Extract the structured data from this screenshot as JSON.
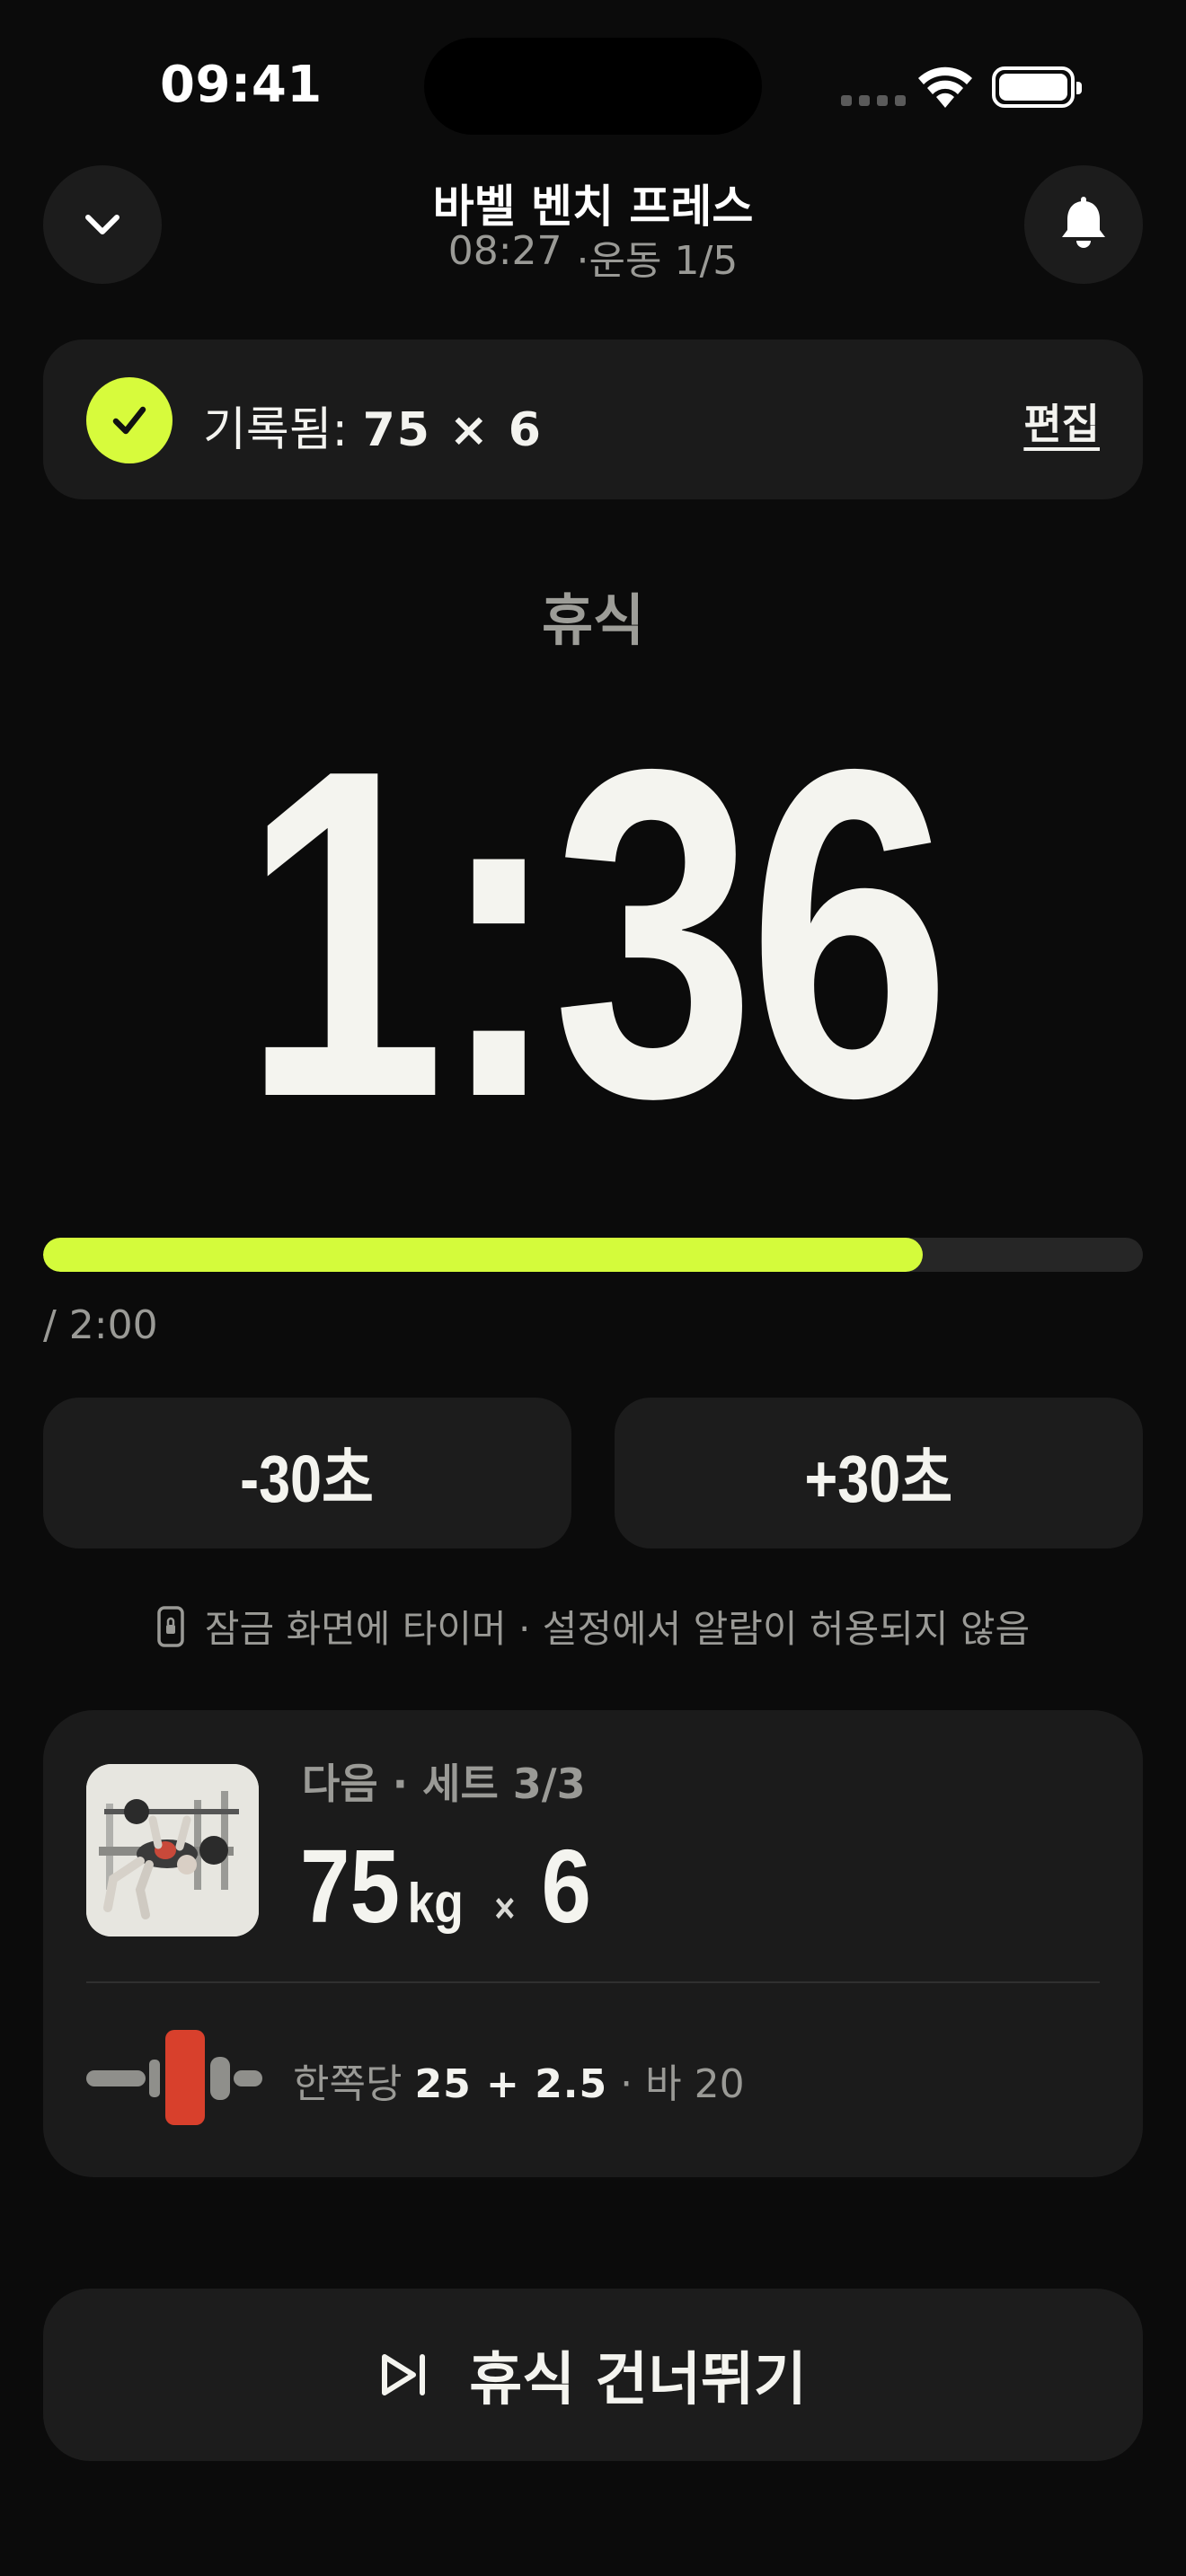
{
  "status_bar": {
    "time": "09:41",
    "icons": [
      "cellular-icon",
      "wifi-icon",
      "battery-icon"
    ]
  },
  "header": {
    "title": "바벨 벤치 프레스",
    "elapsed": "08:27",
    "exercise_progress": "·운동 1/5",
    "left_icon": "chevron-down-icon",
    "right_icon": "bell-icon"
  },
  "logged": {
    "label": "기록됨:",
    "value": "75 × 6",
    "edit_label": "편집",
    "icon": "check-icon",
    "accent": "#d7fb3c"
  },
  "timer": {
    "label": "휴식",
    "remaining": "1:36",
    "total": "/ 2:00",
    "progress_fraction": 0.8
  },
  "adjust": {
    "minus_label": "-30초",
    "plus_label": "+30초"
  },
  "lock_notice": {
    "icon": "lock-icon",
    "text": "잠금 화면에 타이머 · 설정에서 알람이 허용되지 않음"
  },
  "next_set": {
    "label": "다음 · 세트 3/3",
    "weight": "75",
    "unit": "kg",
    "times": "×",
    "reps": "6",
    "thumb_icon": "bench-press-illustration",
    "plate_icon": "barbell-plate-icon",
    "plate_prefix": "한쪽당",
    "plate_value": "25 + 2.5",
    "bar_note": "· 바 20",
    "plate_color": "#d8402c"
  },
  "skip": {
    "label": "휴식 건너뛰기",
    "icon": "skip-forward-icon"
  }
}
